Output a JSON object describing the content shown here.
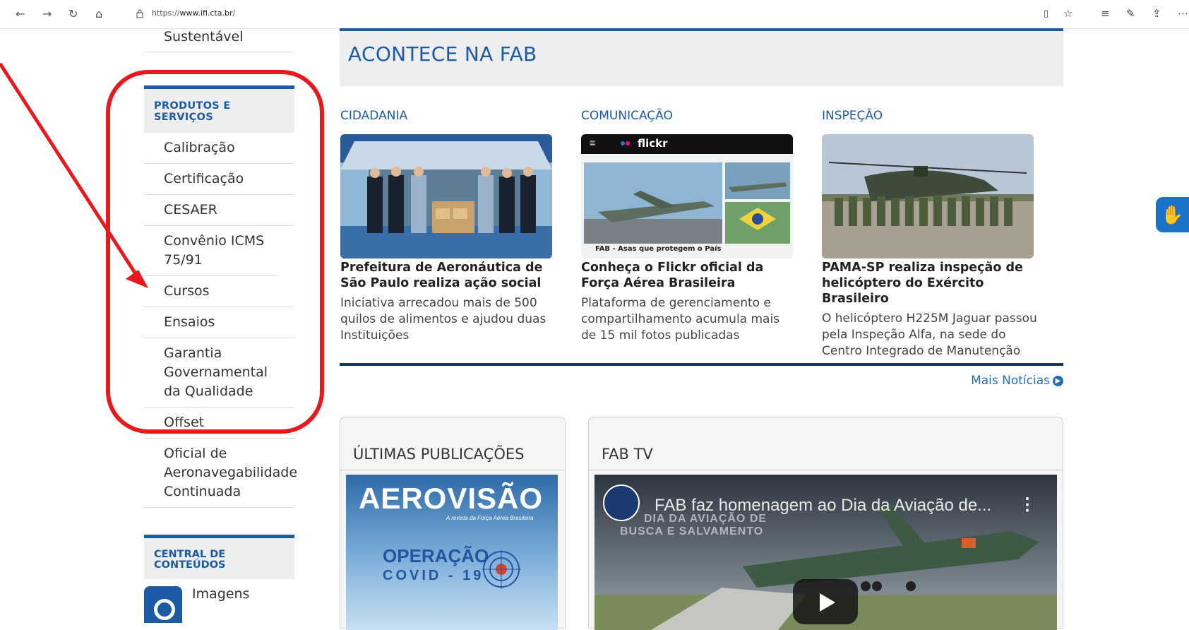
{
  "browser": {
    "url_prefix": "https://",
    "url_host": "www.ifi.cta.br",
    "url_suffix": "/"
  },
  "sidebar": {
    "top_item": "Sustentável",
    "products_heading": "PRODUTOS E SERVIÇOS",
    "items": [
      {
        "label": "Calibração"
      },
      {
        "label": "Certificação"
      },
      {
        "label": "CESAER"
      },
      {
        "label": "Convênio ICMS 75/91"
      },
      {
        "label": "Cursos"
      },
      {
        "label": "Ensaios"
      },
      {
        "label": "Garantia Governamental da Qualidade"
      },
      {
        "label": "Offset"
      },
      {
        "label": "Oficial de Aeronavegabilidade Continuada"
      }
    ],
    "central_heading": "CENTRAL DE CONTEÚDOS",
    "central_item": "Imagens"
  },
  "main": {
    "section_title": "ACONTECE NA FAB",
    "news": [
      {
        "category": "CIDADANIA",
        "title": "Prefeitura de Aeronáutica de São Paulo realiza ação social",
        "description": "Iniciativa arrecadou mais de 500 quilos de alimentos e ajudou duas Instituições"
      },
      {
        "category": "COMUNICAÇÃO",
        "title": "Conheça o Flickr oficial da Força Aérea Brasileira",
        "description": "Plataforma de gerenciamento e compartilhamento acumula mais de 15 mil fotos publicadas"
      },
      {
        "category": "INSPEÇÃO",
        "title": "PAMA-SP realiza inspeção de helicóptero do Exército Brasileiro",
        "description": "O helicóptero H225M Jaguar passou pela Inspeção Alfa, na sede do Centro Integrado de Manutenção"
      }
    ],
    "flickr_logo": "flickr",
    "flickr_caption": "FAB - Asas que protegem o País",
    "more_news": "Mais Notícias",
    "publications_title": "ÚLTIMAS PUBLICAÇÕES",
    "magazine": {
      "name": "AEROVISÃO",
      "tagline": "A revista da Força Aérea Brasileira",
      "headline_1": "OPERAÇÃO",
      "headline_2": "COVID - 19"
    },
    "tv_title": "FAB TV",
    "video": {
      "title": "FAB faz homenagem ao Dia da Aviação de...",
      "overlay_1": "DIA DA AVIAÇÃO DE",
      "overlay_2": "BUSCA E SALVAMENTO"
    }
  },
  "colors": {
    "brand_blue": "#1c5aa6",
    "annotation_red": "#e8191c"
  }
}
